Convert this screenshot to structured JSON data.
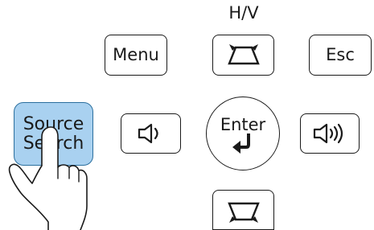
{
  "labels": {
    "hv": "H/V",
    "menu": "Menu",
    "esc": "Esc",
    "enter": "Enter",
    "source_line1": "Source",
    "source_line2": "Search"
  },
  "icons": {
    "keystone_top": "keystone-vertical-icon",
    "keystone_bottom": "keystone-horizontal-icon",
    "volume_down": "volume-down-icon",
    "volume_up": "volume-up-icon",
    "enter_arrow": "enter-arrow-icon",
    "pointing_hand": "pointing-hand-icon"
  },
  "colors": {
    "source_button_fill": "#a9d1f0",
    "source_button_border": "#2b6f9e",
    "outline": "#1a1a1a"
  }
}
